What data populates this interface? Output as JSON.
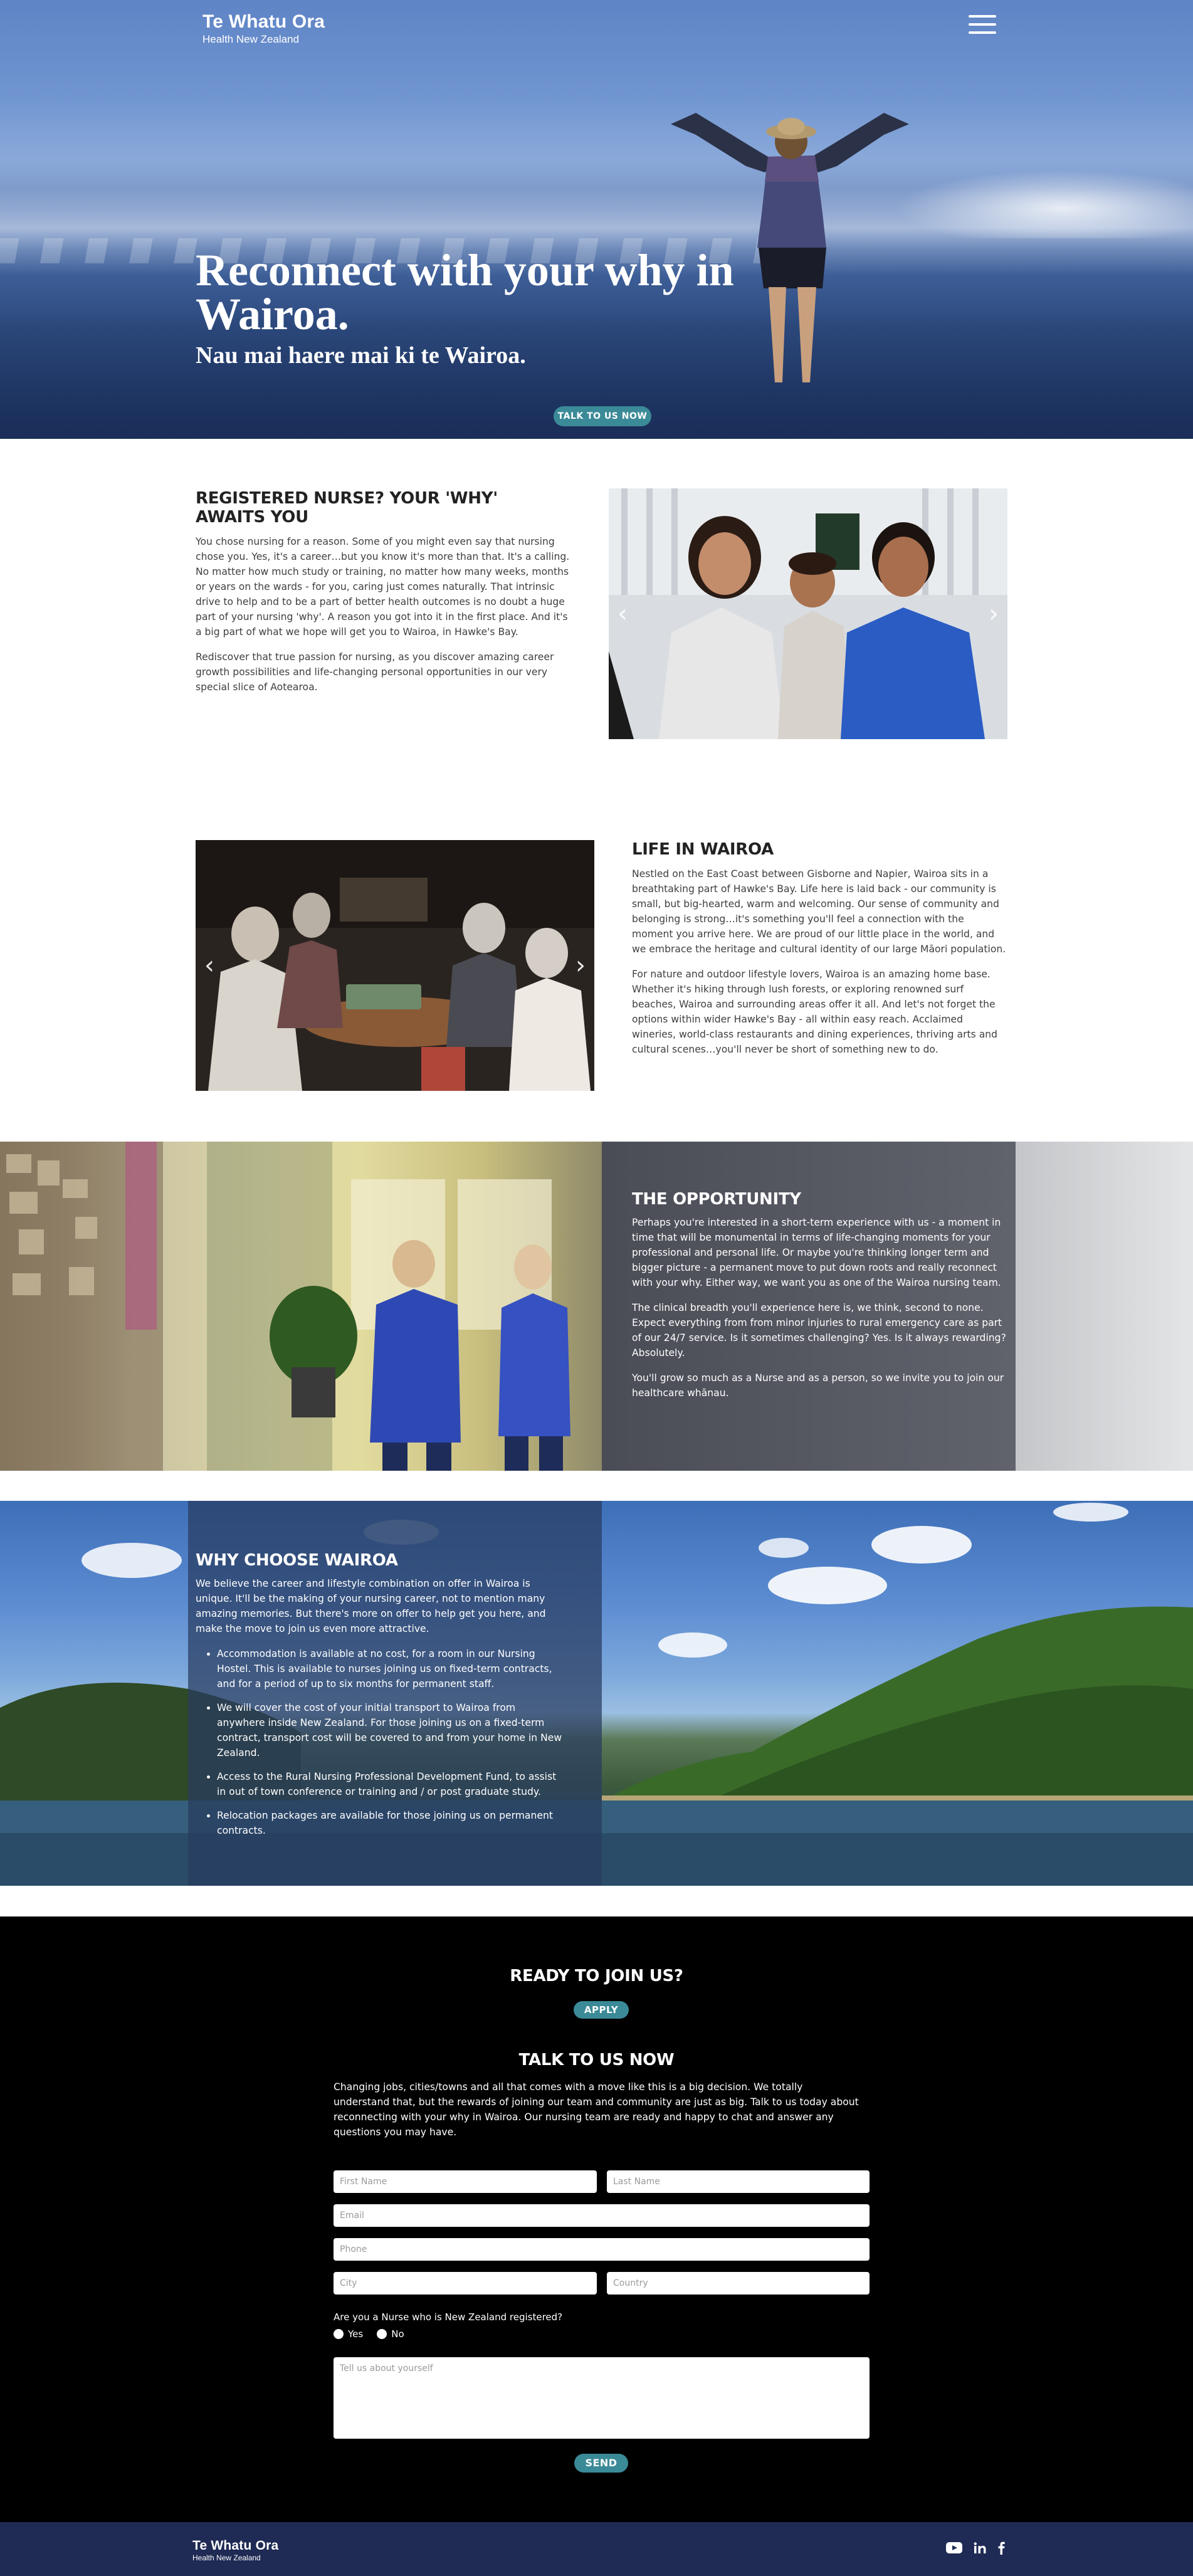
{
  "brand": {
    "name": "Te Whatu Ora",
    "subtitle": "Health New Zealand"
  },
  "hero": {
    "title": "Reconnect with your why in Wairoa.",
    "subtitle": "Nau mai haere mai ki te Wairoa.",
    "cta": "TALK TO US NOW"
  },
  "section_nurse": {
    "heading": "REGISTERED NURSE? YOUR 'WHY' AWAITS YOU",
    "paragraphs": [
      "You chose nursing for a reason. Some of you might even say that nursing chose you. Yes, it's a career…but you know it's more than that. It's a calling. No matter how much study or training, no matter how many weeks, months or years on the wards - for you, caring just comes naturally. That intrinsic drive to help and to be a part of better health outcomes is no doubt a huge part of your nursing 'why'. A reason you got into it in the first place. And it's a big part of what we hope will get you to Wairoa, in Hawke's Bay.",
      "Rediscover that true passion for nursing, as you discover amazing career growth possibilities and life-changing personal opportunities in our very special slice of Aotearoa."
    ]
  },
  "section_life": {
    "heading": "LIFE IN WAIROA",
    "paragraphs": [
      "Nestled on the East Coast between Gisborne and Napier, Wairoa sits in a breathtaking part of Hawke's Bay. Life here is laid back - our community is small, but big-hearted, warm and welcoming. Our sense of community and belonging is strong…it's something you'll feel a connection with the moment you arrive here. We are proud of our little place in the world, and we embrace the heritage and cultural identity of our large Māori population.",
      "For nature and outdoor lifestyle lovers, Wairoa is an amazing home base. Whether it's hiking through lush forests, or exploring renowned surf beaches, Wairoa and surrounding areas offer it all. And let's not forget the options within wider Hawke's Bay - all within easy reach. Acclaimed wineries, world-class restaurants and dining experiences, thriving arts and cultural scenes…you'll never be short of something new to do."
    ]
  },
  "section_opportunity": {
    "heading": "THE OPPORTUNITY",
    "paragraphs": [
      "Perhaps you're interested in a short-term experience with us - a moment in time that will be monumental in terms of life-changing moments for your professional and personal life. Or maybe you're thinking longer term and bigger picture - a permanent move to put down roots and really reconnect with your why. Either way, we want you as one of the Wairoa nursing team.",
      "The clinical breadth you'll experience here is, we think, second to none. Expect everything from from minor injuries to rural emergency care as part of our 24/7 service. Is it sometimes challenging? Yes. Is it always rewarding? Absolutely.",
      "You'll grow so much as a Nurse and as a person, so we invite you to join our healthcare whānau."
    ]
  },
  "section_why": {
    "heading": "WHY CHOOSE WAIROA",
    "intro": "We believe the career and lifestyle combination on offer in Wairoa is unique. It'll be the making of your nursing career, not to mention many amazing memories. But there's more on offer to help get you here, and make the move to join us even more attractive.",
    "bullets": [
      "Accommodation is available at no cost, for a room in our Nursing Hostel. This is available to nurses joining us on fixed-term contracts, and for a period of up to six months for permanent staff.",
      "We will cover the cost of your initial transport to Wairoa from anywhere inside New Zealand. For those joining us on a fixed-term contract, transport cost will be covered to and from your home in New Zealand.",
      "Access to the Rural Nursing Professional Development Fund, to assist in out of town conference or training and / or post graduate study.",
      "Relocation packages are available for those joining us on permanent contracts."
    ]
  },
  "contact": {
    "ready_heading": "READY TO JOIN US?",
    "apply_label": "APPLY",
    "talk_heading": "TALK TO US NOW",
    "intro": "Changing jobs, cities/towns and all that comes with a move like this is a big decision. We totally understand that, but the rewards of joining our team and community are just as big. Talk to us today about reconnecting with your why in Wairoa. Our nursing team are ready and happy to chat and answer any questions you may have.",
    "placeholders": {
      "first_name": "First Name",
      "last_name": "Last Name",
      "email": "Email",
      "phone": "Phone",
      "city": "City",
      "country": "Country",
      "about": "Tell us about yourself"
    },
    "question": "Are you a Nurse who is New Zealand registered?",
    "option_yes": "Yes",
    "option_no": "No",
    "send_label": "SEND"
  },
  "footer": {
    "socials": [
      "youtube-icon",
      "linkedin-icon",
      "facebook-icon"
    ]
  },
  "colors": {
    "accent": "#3b8a98",
    "footer_bg": "#1f2a55",
    "contact_bg": "#000000"
  }
}
